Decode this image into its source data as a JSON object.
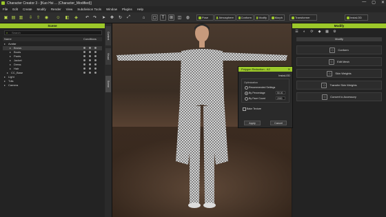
{
  "window": {
    "title": "Character Creator 3 - [Kuo Hsi ... (Character_Modified)]",
    "controls": [
      "—",
      "▢",
      "✕"
    ]
  },
  "menu": [
    "File",
    "Edit",
    "Create",
    "Modify",
    "Render",
    "View",
    "Subdivision Tools",
    "Window",
    "Plugins",
    "Help"
  ],
  "toolbar": {
    "pose_label": "Pose",
    "atmosphere_label": "Atmosphere",
    "conform_label": "Conform",
    "modify_label": "Modify",
    "morph_label": "Morph",
    "transformer_label": "Transformer",
    "instalod_label": "InstaLOD"
  },
  "scene": {
    "header": "Scene",
    "search_placeholder": "Search",
    "columns": {
      "name": "Name",
      "conditions": "Conditions"
    },
    "rows": [
      {
        "label": "Avatar",
        "indent": 0,
        "selected": false,
        "icons": false
      },
      {
        "label": "Brows",
        "indent": 2,
        "selected": true,
        "icons": true
      },
      {
        "label": "Boots",
        "indent": 2,
        "selected": false,
        "icons": true
      },
      {
        "label": "Pants",
        "indent": 2,
        "selected": false,
        "icons": true
      },
      {
        "label": "Jacket",
        "indent": 2,
        "selected": false,
        "icons": true
      },
      {
        "label": "Dress",
        "indent": 2,
        "selected": false,
        "icons": true
      },
      {
        "label": "Hair",
        "indent": 2,
        "selected": false,
        "icons": true
      },
      {
        "label": "CC_Base",
        "indent": 1,
        "selected": false,
        "icons": true
      },
      {
        "label": "Light",
        "indent": 0,
        "selected": false,
        "icons": false
      },
      {
        "label": "Tdis",
        "indent": 0,
        "selected": false,
        "icons": false
      },
      {
        "label": "Camera",
        "indent": 0,
        "selected": false,
        "icons": false
      }
    ]
  },
  "side_tabs": [
    "Content",
    "Visual",
    "Scene"
  ],
  "modify": {
    "header": "Modify",
    "section_title": "Modify",
    "buttons": [
      {
        "label": "Conform",
        "icon": "conform-icon"
      },
      {
        "label": "Edit Mesh",
        "icon": "edit-mesh-icon"
      },
      {
        "label": "Skin Weights",
        "icon": "skin-weights-icon"
      },
      {
        "label": "Transfer Skin Weights",
        "icon": "transfer-icon"
      },
      {
        "label": "Convert to Accessory",
        "icon": "accessory-icon"
      }
    ]
  },
  "dialog": {
    "title": "Polygon Reduction - A2",
    "brand": "InstaLOD",
    "section_label": "Optimization",
    "options": [
      {
        "label": "Recommended Settings",
        "selected": false
      },
      {
        "label": "By Percentage",
        "selected": true,
        "value": "50.00"
      },
      {
        "label": "By Face Count",
        "selected": false,
        "value": "2000"
      }
    ],
    "bake_texture_label": "Bake Texture",
    "apply_label": "Apply",
    "cancel_label": "Cancel"
  },
  "colors": {
    "accent": "#9cc82a",
    "panel": "#232323",
    "background": "#1b1b1b"
  }
}
